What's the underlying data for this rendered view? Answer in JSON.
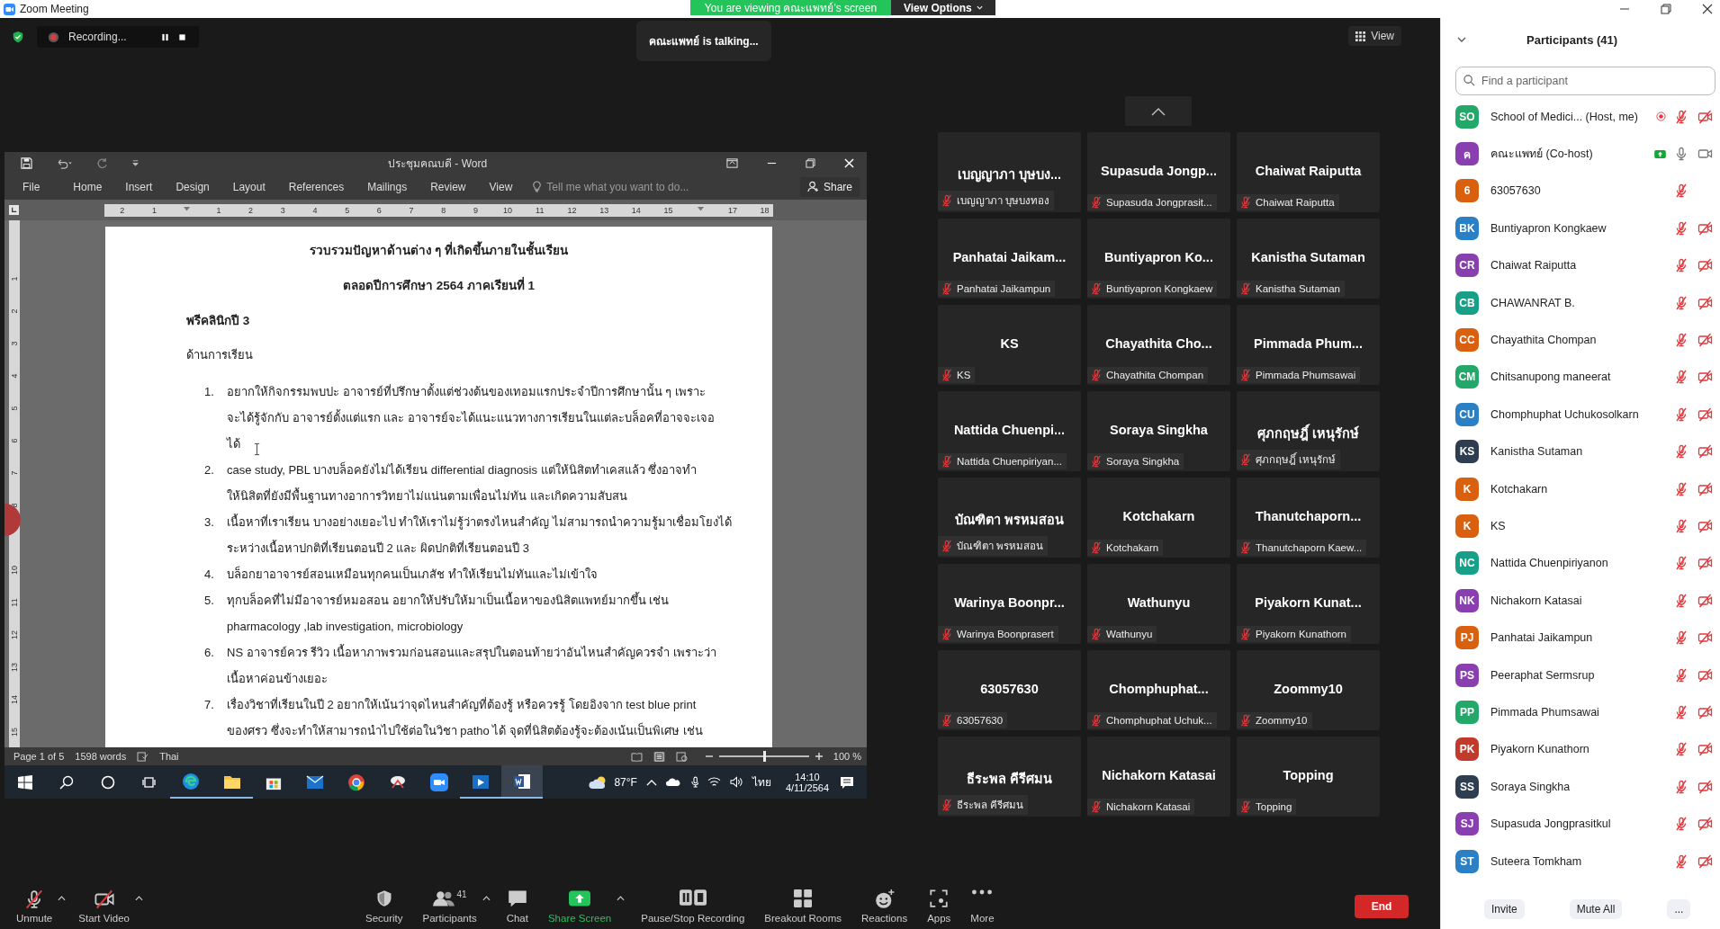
{
  "window": {
    "title": "Zoom Meeting"
  },
  "share_banner": {
    "text": "You are viewing คณะแพทย์'s screen",
    "button": "View Options"
  },
  "recording": {
    "label": "Recording..."
  },
  "talking": "คณะแพทย์ is talking...",
  "view_button": "View",
  "shared_word": {
    "title": "ประชุมคณบดี - Word",
    "menu": [
      "File",
      "Home",
      "Insert",
      "Design",
      "Layout",
      "References",
      "Mailings",
      "Review",
      "View"
    ],
    "tell_me": "Tell me what you want to do...",
    "share": "Share",
    "ruler": [
      {
        "kind": "number",
        "label": "2"
      },
      {
        "kind": "number",
        "label": "1"
      },
      {
        "kind": "marker"
      },
      {
        "kind": "number",
        "label": "1"
      },
      {
        "kind": "number",
        "label": "2"
      },
      {
        "kind": "number",
        "label": "3"
      },
      {
        "kind": "number",
        "label": "4"
      },
      {
        "kind": "number",
        "label": "5"
      },
      {
        "kind": "number",
        "label": "6"
      },
      {
        "kind": "number",
        "label": "7"
      },
      {
        "kind": "number",
        "label": "8"
      },
      {
        "kind": "number",
        "label": "9"
      },
      {
        "kind": "number",
        "label": "10"
      },
      {
        "kind": "number",
        "label": "11"
      },
      {
        "kind": "number",
        "label": "12"
      },
      {
        "kind": "number",
        "label": "13"
      },
      {
        "kind": "number",
        "label": "14"
      },
      {
        "kind": "number",
        "label": "15"
      },
      {
        "kind": "marker"
      },
      {
        "kind": "number",
        "label": "17"
      },
      {
        "kind": "number",
        "label": "18"
      }
    ],
    "vruler": [
      {
        "kind": "number",
        "label": "1"
      },
      {
        "kind": "number",
        "label": "2"
      },
      {
        "kind": "number",
        "label": "3"
      },
      {
        "kind": "number",
        "label": "4"
      },
      {
        "kind": "number",
        "label": "5"
      },
      {
        "kind": "number",
        "label": "6"
      },
      {
        "kind": "number",
        "label": "7"
      },
      {
        "kind": "number",
        "label": "8"
      },
      {
        "kind": "gap"
      },
      {
        "kind": "number",
        "label": "10"
      },
      {
        "kind": "number",
        "label": "11"
      },
      {
        "kind": "number",
        "label": "12"
      },
      {
        "kind": "number",
        "label": "13"
      },
      {
        "kind": "number",
        "label": "14"
      },
      {
        "kind": "number",
        "label": "15"
      }
    ],
    "document": {
      "titles": [
        "รวบรวมปัญหาด้านต่าง ๆ ที่เกิดขึ้นภายในชั้นเรียน",
        "ตลอดปีการศึกษา 2564 ภาคเรียนที่ 1"
      ],
      "section": "พรีคลินิกปี 3",
      "subsection": "ด้านการเรียน",
      "items": [
        {
          "number": "1.",
          "lines": [
            "อยากให้กิจกรรมพบปะ อาจารย์ที่ปรึกษาตั้งแต่ช่วงต้นของเทอมแรกประจำปีการศึกษานั้น ๆ เพราะ",
            "จะได้รู้จักกับ อาจารย์ตั้งแต่แรก และ อาจารย์จะได้แนะแนวทางการเรียนในแต่ละบล็อคที่อาจจะเจอ",
            "ได้"
          ]
        },
        {
          "number": "2.",
          "lines": [
            "case study, PBL บางบล็อคยังไม่ได้เรียน differential diagnosis แต่ให้นิสิตทำเคสแล้ว ซึ่งอาจทำ",
            "ให้นิสิตที่ยังมีพื้นฐานทางอาการวิทยาไม่แน่นตามเพื่อนไม่ทัน และเกิดความสับสน"
          ]
        },
        {
          "number": "3.",
          "lines": [
            "เนื้อหาที่เราเรียน บางอย่างเยอะไป ทำให้เราไม่รู้ว่าตรงไหนสำคัญ ไม่สามารถนำความรู้มาเชื่อมโยงได้",
            "ระหว่างเนื้อหาปกติที่เรียนตอนปี 2 และ ผิดปกติที่เรียนตอนปี 3"
          ]
        },
        {
          "number": "4.",
          "lines": [
            "บล็อกยาอาจารย์สอนเหมือนทุกคนเป็นเภสัช ทำให้เรียนไม่ทันและไม่เข้าใจ"
          ]
        },
        {
          "number": "5.",
          "lines": [
            "ทุกบล็อคที่ไม่มีอาจารย์หมอสอน อยากให้ปรับให้มาเป็นเนื้อหาของนิสิตแพทย์มากขึ้น เช่น",
            "pharmacology ,lab investigation, microbiology"
          ]
        },
        {
          "number": "6.",
          "lines": [
            "NS อาจารย์ควร รีวิว เนื้อหาภาพรวมก่อนสอนและสรุปในตอนท้ายว่าอันไหนสำคัญควรจำ เพราะว่า",
            "เนื้อหาค่อนข้างเยอะ"
          ]
        },
        {
          "number": "7.",
          "lines": [
            "เรื่องวิชาที่เรียนในปี 2 อยากให้เน้นว่าจุดไหนสำคัญที่ต้องรู้ หรือควรรู้ โดยอิงจาก test blue print",
            "ของศรว ซึ่งจะทำให้สามารถนำไปใช้ต่อในวิชา patho ได้ จุดที่นิสิตต้องรู้จะต้องเน้นเป็นพิเศษ เช่น"
          ]
        }
      ]
    },
    "status": {
      "page": "Page 1 of 5",
      "words": "1598 words",
      "language": "Thai",
      "zoom": "100 %",
      "zoom_slider": {
        "level": 0.5
      }
    },
    "taskbar": {
      "weather": "87°F",
      "input_language": "ไทย",
      "time": "14:10",
      "date": "4/11/2564"
    }
  },
  "tiles": [
    {
      "title": "เบญญาภา บุษบง...",
      "name": "เบญญาภา บุษบงทอง",
      "muted": true
    },
    {
      "title": "Supasuda Jongp...",
      "name": "Supasuda Jongprasit...",
      "muted": true
    },
    {
      "title": "Chaiwat Raiputta",
      "name": "Chaiwat Raiputta",
      "muted": true
    },
    {
      "title": "Panhatai Jaikam...",
      "name": "Panhatai Jaikampun",
      "muted": true
    },
    {
      "title": "Buntiyapron Ko...",
      "name": "Buntiyapron Kongkaew",
      "muted": true
    },
    {
      "title": "Kanistha Sutaman",
      "name": "Kanistha Sutaman",
      "muted": true
    },
    {
      "title": "KS",
      "name": "KS",
      "muted": true
    },
    {
      "title": "Chayathita Cho...",
      "name": "Chayathita Chompan",
      "muted": true
    },
    {
      "title": "Pimmada Phum...",
      "name": "Pimmada Phumsawai",
      "muted": true
    },
    {
      "title": "Nattida Chuenpi...",
      "name": "Nattida Chuenpiriyan...",
      "muted": true
    },
    {
      "title": "Soraya Singkha",
      "name": "Soraya Singkha",
      "muted": true
    },
    {
      "title": "ศุภกฤษฎิ์ เหนุรักษ์",
      "name": "ศุภกฤษฎิ์ เหนุรักษ์",
      "muted": true
    },
    {
      "title": "บัณฑิตา พรหมสอน",
      "name": "บัณฑิตา พรหมสอน",
      "muted": true
    },
    {
      "title": "Kotchakarn",
      "name": "Kotchakarn",
      "muted": true
    },
    {
      "title": "Thanutchaporn...",
      "name": "Thanutchaporn Kaew...",
      "muted": true
    },
    {
      "title": "Warinya Boonpr...",
      "name": "Warinya Boonprasert",
      "muted": true
    },
    {
      "title": "Wathunyu",
      "name": "Wathunyu",
      "muted": true
    },
    {
      "title": "Piyakorn Kunat...",
      "name": "Piyakorn Kunathorn",
      "muted": true
    },
    {
      "title": "63057630",
      "name": "63057630",
      "muted": true
    },
    {
      "title": "Chomphuphat...",
      "name": "Chomphuphat Uchuk...",
      "muted": true
    },
    {
      "title": "Zoommy10",
      "name": "Zoommy10",
      "muted": true
    },
    {
      "title": "ธีระพล คีรีศมน",
      "name": "ธีระพล คีรีศมน",
      "muted": true
    },
    {
      "title": "Nichakorn Katasai",
      "name": "Nichakorn Katasai",
      "muted": true
    },
    {
      "title": "Topping",
      "name": "Topping",
      "muted": true
    }
  ],
  "toolbar": [
    {
      "kind": "mic-off",
      "label": "Unmute",
      "caret": true
    },
    {
      "kind": "video-off",
      "label": "Start Video",
      "caret": true
    },
    {
      "kind": "security",
      "label": "Security",
      "caret": false
    },
    {
      "kind": "participants",
      "label": "Participants",
      "count": "41",
      "caret": true
    },
    {
      "kind": "chat",
      "label": "Chat",
      "caret": false
    },
    {
      "kind": "share",
      "label": "Share Screen",
      "caret": true
    },
    {
      "kind": "record",
      "label": "Pause/Stop Recording",
      "caret": false
    },
    {
      "kind": "breakout",
      "label": "Breakout Rooms",
      "caret": false
    },
    {
      "kind": "reactions",
      "label": "Reactions",
      "caret": false
    },
    {
      "kind": "apps",
      "label": "Apps",
      "caret": false
    },
    {
      "kind": "more",
      "label": "More",
      "caret": false
    }
  ],
  "end_button": "End",
  "participants": {
    "title": "Participants (41)",
    "search": {
      "placeholder": "Find a participant"
    },
    "items": [
      {
        "initials": "SO",
        "color": "#23a869",
        "name": "School of Medici... (Host, me)",
        "recording": true,
        "sharing": false,
        "mic_muted": true,
        "video_off": true
      },
      {
        "initials": "ค",
        "color": "#8a3fb0",
        "name": "คณะแพทย์ (Co-host)",
        "recording": false,
        "sharing": true,
        "mic_muted": false,
        "video_off": false
      },
      {
        "initials": "6",
        "color": "#d9600f",
        "name": "63057630",
        "recording": false,
        "sharing": false,
        "mic_muted": true
      },
      {
        "initials": "BK",
        "color": "#2b7fc4",
        "name": "Buntiyapron Kongkaew",
        "recording": false,
        "sharing": false,
        "mic_muted": true,
        "video_off": true
      },
      {
        "initials": "CR",
        "color": "#8a3fb0",
        "name": "Chaiwat Raiputta",
        "recording": false,
        "sharing": false,
        "mic_muted": true,
        "video_off": true
      },
      {
        "initials": "CB",
        "color": "#17a087",
        "name": "CHAWANRAT B.",
        "recording": false,
        "sharing": false,
        "mic_muted": true,
        "video_off": true
      },
      {
        "initials": "CC",
        "color": "#d9600f",
        "name": "Chayathita Chompan",
        "recording": false,
        "sharing": false,
        "mic_muted": true,
        "video_off": true
      },
      {
        "initials": "CM",
        "color": "#23a869",
        "name": "Chitsanupong maneerat",
        "recording": false,
        "sharing": false,
        "mic_muted": true,
        "video_off": true
      },
      {
        "initials": "CU",
        "color": "#2b7fc4",
        "name": "Chomphuphat Uchukosolkarn",
        "recording": false,
        "sharing": false,
        "mic_muted": true,
        "video_off": true
      },
      {
        "initials": "KS",
        "color": "#2e3e50",
        "name": "Kanistha Sutaman",
        "recording": false,
        "sharing": false,
        "mic_muted": true,
        "video_off": true
      },
      {
        "initials": "K",
        "color": "#d9600f",
        "name": "Kotchakarn",
        "recording": false,
        "sharing": false,
        "mic_muted": true,
        "video_off": true
      },
      {
        "initials": "K",
        "color": "#d9600f",
        "name": "KS",
        "recording": false,
        "sharing": false,
        "mic_muted": true,
        "video_off": true
      },
      {
        "initials": "NC",
        "color": "#17a087",
        "name": "Nattida Chuenpiriyanon",
        "recording": false,
        "sharing": false,
        "mic_muted": true,
        "video_off": true
      },
      {
        "initials": "NK",
        "color": "#8a3fb0",
        "name": "Nichakorn Katasai",
        "recording": false,
        "sharing": false,
        "mic_muted": true,
        "video_off": true
      },
      {
        "initials": "PJ",
        "color": "#d9600f",
        "name": "Panhatai Jaikampun",
        "recording": false,
        "sharing": false,
        "mic_muted": true,
        "video_off": true
      },
      {
        "initials": "PS",
        "color": "#8a3fb0",
        "name": "Peeraphat Sermsrup",
        "recording": false,
        "sharing": false,
        "mic_muted": true,
        "video_off": true
      },
      {
        "initials": "PP",
        "color": "#23a869",
        "name": "Pimmada Phumsawai",
        "recording": false,
        "sharing": false,
        "mic_muted": true,
        "video_off": true
      },
      {
        "initials": "PK",
        "color": "#c23a2b",
        "name": "Piyakorn Kunathorn",
        "recording": false,
        "sharing": false,
        "mic_muted": true,
        "video_off": true
      },
      {
        "initials": "SS",
        "color": "#2e3e50",
        "name": "Soraya Singkha",
        "recording": false,
        "sharing": false,
        "mic_muted": true,
        "video_off": true
      },
      {
        "initials": "SJ",
        "color": "#8a3fb0",
        "name": "Supasuda Jongprasitkul",
        "recording": false,
        "sharing": false,
        "mic_muted": true,
        "video_off": true
      },
      {
        "initials": "ST",
        "color": "#2b7fc4",
        "name": "Suteera Tomkham",
        "recording": false,
        "sharing": false,
        "mic_muted": true,
        "video_off": true
      }
    ],
    "buttons": [
      "Invite",
      "Mute All",
      "..."
    ]
  }
}
